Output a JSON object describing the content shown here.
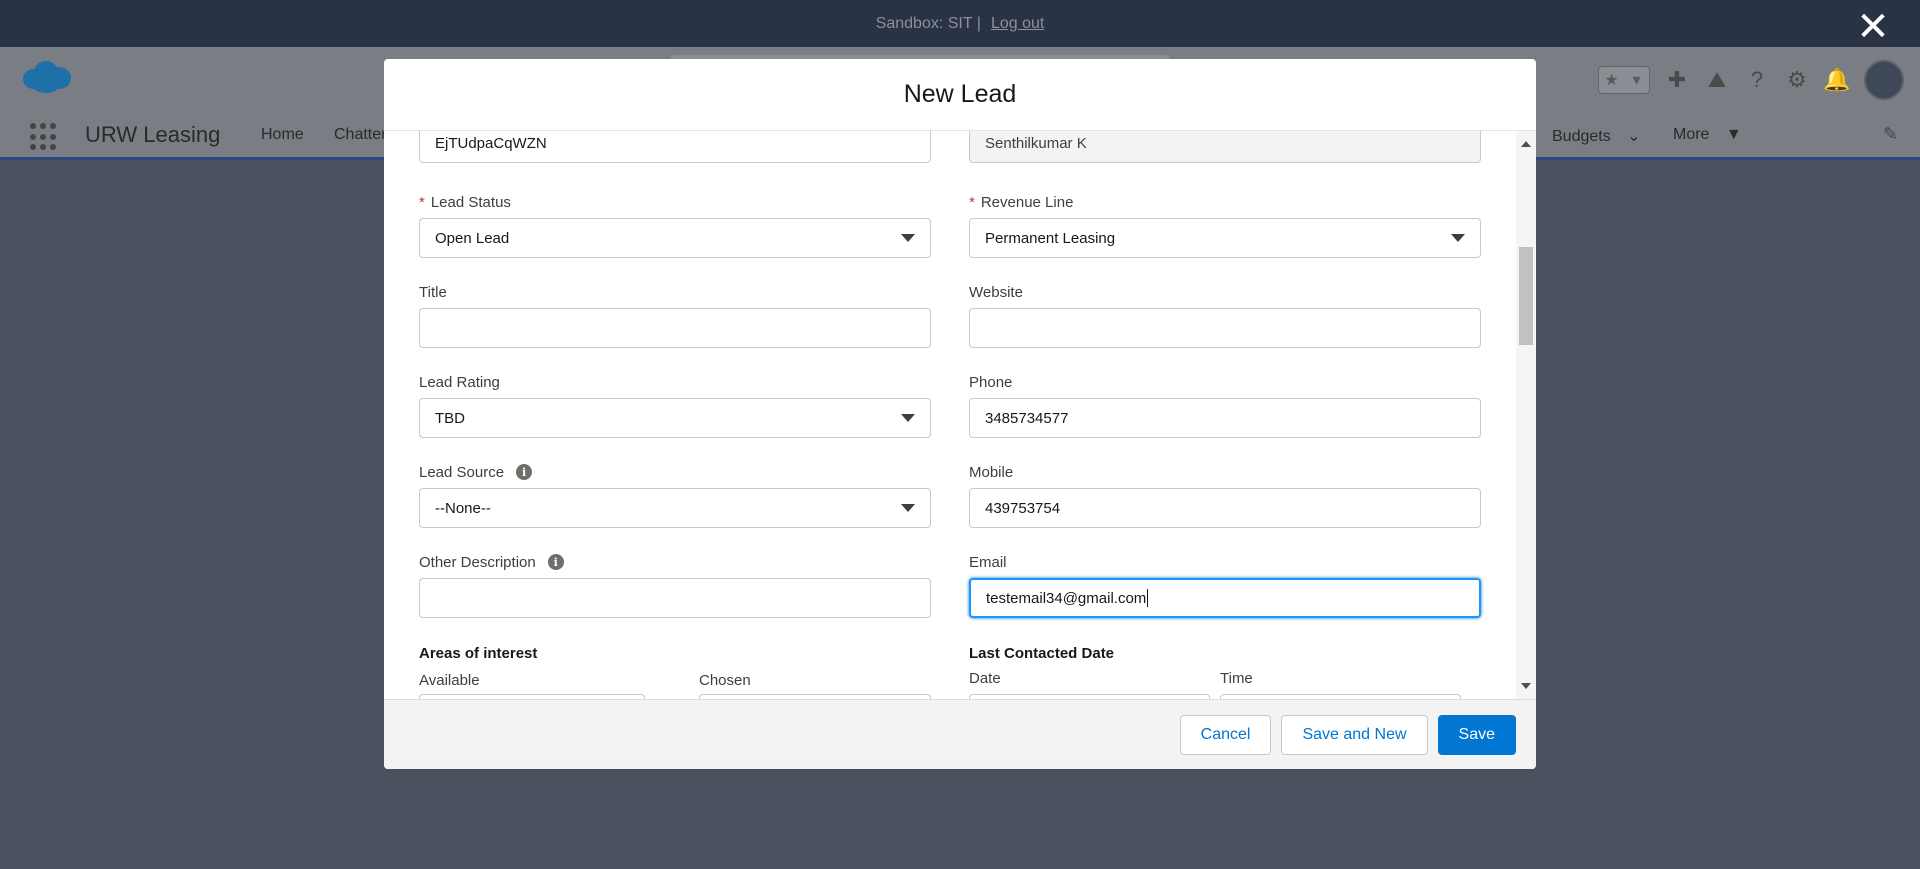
{
  "sandbox": {
    "text": "Sandbox: SIT |",
    "logout": "Log out"
  },
  "header": {
    "app_name": "URW Leasing",
    "nav": [
      {
        "label": "Home"
      },
      {
        "label": "Chatter"
      },
      {
        "label": "Budgets"
      },
      {
        "label": "More"
      }
    ]
  },
  "modal": {
    "title": "New Lead",
    "fields": {
      "top_left_value": "EjTUdpaCqWZN",
      "top_right_value": "Senthilkumar K",
      "lead_status": {
        "label": "Lead Status",
        "value": "Open Lead"
      },
      "revenue_line": {
        "label": "Revenue Line",
        "value": "Permanent Leasing"
      },
      "title": {
        "label": "Title",
        "value": ""
      },
      "website": {
        "label": "Website",
        "value": ""
      },
      "lead_rating": {
        "label": "Lead Rating",
        "value": "TBD"
      },
      "phone": {
        "label": "Phone",
        "value": "3485734577"
      },
      "lead_source": {
        "label": "Lead Source",
        "value": "--None--"
      },
      "mobile": {
        "label": "Mobile",
        "value": "439753754"
      },
      "other_description": {
        "label": "Other Description",
        "value": ""
      },
      "email": {
        "label": "Email",
        "value": "testemail34@gmail.com"
      }
    },
    "areas_of_interest": {
      "title": "Areas of interest",
      "available": "Available",
      "chosen": "Chosen"
    },
    "last_contacted": {
      "title": "Last Contacted Date",
      "date": "Date",
      "time": "Time"
    },
    "buttons": {
      "cancel": "Cancel",
      "save_and_new": "Save and New",
      "save": "Save"
    }
  },
  "colors": {
    "brand": "#0176d3",
    "required": "#c23934",
    "sandbox_bar": "#2a3346"
  }
}
